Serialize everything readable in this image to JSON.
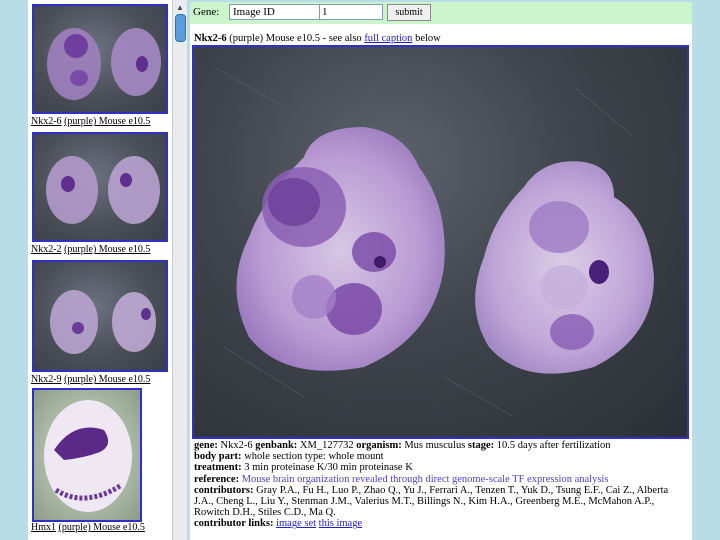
{
  "thumbnails": [
    {
      "gene": "Nkx2-6",
      "rest": "(purple) Mouse e10.5"
    },
    {
      "gene": "Nkx2-2",
      "rest": "(purple) Mouse e10.5"
    },
    {
      "gene": "Nkx2-9",
      "rest": "(purple) Mouse e10.5"
    },
    {
      "gene": "Hmx1",
      "rest": "(purple) Mouse e10.5"
    }
  ],
  "query": {
    "gene_label": "Gene:",
    "select_value": "Image ID",
    "id_value": "1",
    "submit_label": "submit"
  },
  "image_title": {
    "gene": "Nkx2-6",
    "rest": " (purple) Mouse e10.5 - see also ",
    "link": "full caption",
    "after": " below"
  },
  "caption": {
    "gene_label": "gene:",
    "gene_value": "Nkx2-6",
    "genbank_label": "genbank:",
    "genbank_value": "XM_127732",
    "organism_label": "organism:",
    "organism_value": "Mus musculus",
    "stage_label": "stage:",
    "stage_value": "10.5 days after fertilization",
    "body_part_label": "body part:",
    "body_part_value": "whole section type: whole mount",
    "treatment_label": "treatment:",
    "treatment_value": "3 min proteinase K/30 min proteinase K",
    "reference_label": "reference:",
    "reference_value": "Mouse brain organization revealed through direct genome-scale TF expression analysis",
    "contributors_label": "contributors:",
    "contributors_value": "Gray P.A., Fu H., Luo P., Zhao Q., Yu J., Ferrari A., Tenzen T., Yuk D., Tsung E.F., Cai Z., Alberta J.A., Cheng L., Liu Y., Stenman J.M., Valerius M.T., Billings N., Kim H.A., Greenberg M.E., McMahon A.P., Rowitch D.H., Stiles C.D., Ma Q.",
    "links_label": "contributor links:",
    "link_image_set": "image set",
    "link_this_image": "this image"
  }
}
